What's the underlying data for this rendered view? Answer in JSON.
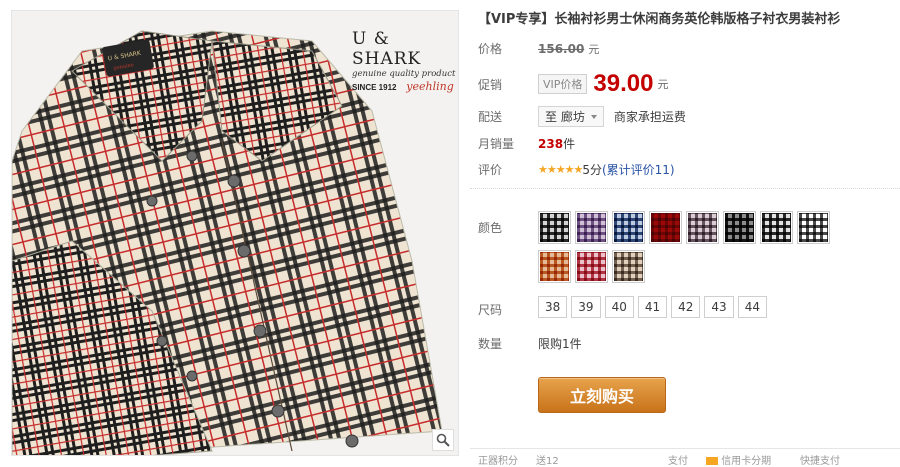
{
  "brand": {
    "name": "U & SHARK",
    "tagline": "genuine quality product",
    "since": "SINCE 1912",
    "signature": "yeehling",
    "label_top": "U & SHARK",
    "label_bottom": "genuine"
  },
  "product": {
    "title": "【VIP专享】长袖衬衫男士休闲商务英伦韩版格子衬衣男装衬衫"
  },
  "price_row": {
    "label": "价格",
    "value": "156.00",
    "unit": "元"
  },
  "promo_row": {
    "label": "促销",
    "badge": "VIP价格",
    "value": "39.00",
    "unit": "元"
  },
  "shipping_row": {
    "label": "配送",
    "location": "至 廊坊",
    "note": "商家承担运费"
  },
  "sales_row": {
    "label": "月销量",
    "count": "238",
    "unit": "件"
  },
  "rating_row": {
    "label": "评价",
    "stars": "★★★★★",
    "score": "5分",
    "review_link": "(累计评价11)"
  },
  "options": {
    "color_label": "颜色",
    "colors": [
      {
        "name": "black-white-check",
        "c1": "#2b2b2b",
        "c2": "#e8e8e8"
      },
      {
        "name": "purple-check",
        "c1": "#7a5c8e",
        "c2": "#e6dde9"
      },
      {
        "name": "blue-check",
        "c1": "#34507e",
        "c2": "#dde3ee"
      },
      {
        "name": "red-black",
        "c1": "#8b1d1d",
        "c2": "#c62d2d"
      },
      {
        "name": "gray-pink-check",
        "c1": "#6d5c66",
        "c2": "#ece4e8"
      },
      {
        "name": "black-check",
        "c1": "#1a1a1a",
        "c2": "#bdbdbd"
      },
      {
        "name": "dark-check",
        "c1": "#2a2a2a",
        "c2": "#f0f0f0"
      },
      {
        "name": "white-check",
        "c1": "#4a4a4a",
        "c2": "#ffffff"
      },
      {
        "name": "orange-check",
        "c1": "#c4662a",
        "c2": "#f1dac5"
      },
      {
        "name": "red-white-check",
        "c1": "#b83b4b",
        "c2": "#f4dfe3"
      },
      {
        "name": "beige-check",
        "c1": "#7b6a5c",
        "c2": "#efe6dc"
      }
    ],
    "size_label": "尺码",
    "sizes": [
      "38",
      "39",
      "40",
      "41",
      "42",
      "43",
      "44"
    ],
    "qty_label": "数量",
    "qty_note": "限购1件",
    "buy_label": "立刻购买"
  },
  "footer_strip": {
    "left": "正器积分",
    "left_value": "送12",
    "mid": "支付",
    "tag": "信用卡分期",
    "right": "快捷支付"
  },
  "colors": {
    "price_red": "#c40000",
    "star": "#f5a623",
    "link": "#2953a6",
    "buy_orange": "#d98a2e"
  }
}
